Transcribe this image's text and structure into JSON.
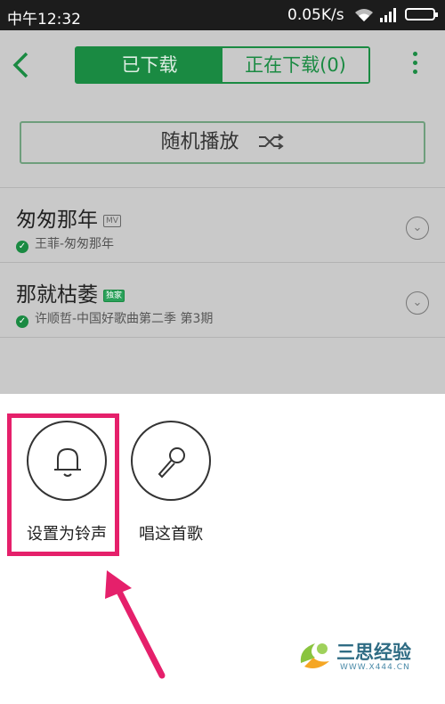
{
  "status_bar": {
    "time": "中午12:32",
    "network_speed": "0.05K/s",
    "icons": [
      "wifi-icon",
      "signal-icon",
      "battery-icon"
    ]
  },
  "header": {
    "back_icon": "chevron-left-icon",
    "tabs": [
      {
        "label": "已下载",
        "active": true
      },
      {
        "label": "正在下载(0)",
        "active": false
      }
    ],
    "more_icon": "more-vertical-icon"
  },
  "shuffle": {
    "label": "随机播放",
    "icon": "shuffle-icon"
  },
  "songs": [
    {
      "title": "匆匆那年",
      "tag": "MV",
      "subtitle": "王菲-匆匆那年"
    },
    {
      "title": "那就枯萎",
      "tag": "独家",
      "subtitle": "许顺哲-中国好歌曲第二季 第3期"
    }
  ],
  "sheet": {
    "actions": [
      {
        "label": "设置为铃声",
        "icon": "bell-icon"
      },
      {
        "label": "唱这首歌",
        "icon": "microphone-icon"
      }
    ]
  },
  "watermark": {
    "text": "三思经验",
    "url": "WWW.X444.CN"
  },
  "colors": {
    "accent": "#1a8a42",
    "highlight": "#e5206b",
    "overlay": "#c9c9c9"
  }
}
